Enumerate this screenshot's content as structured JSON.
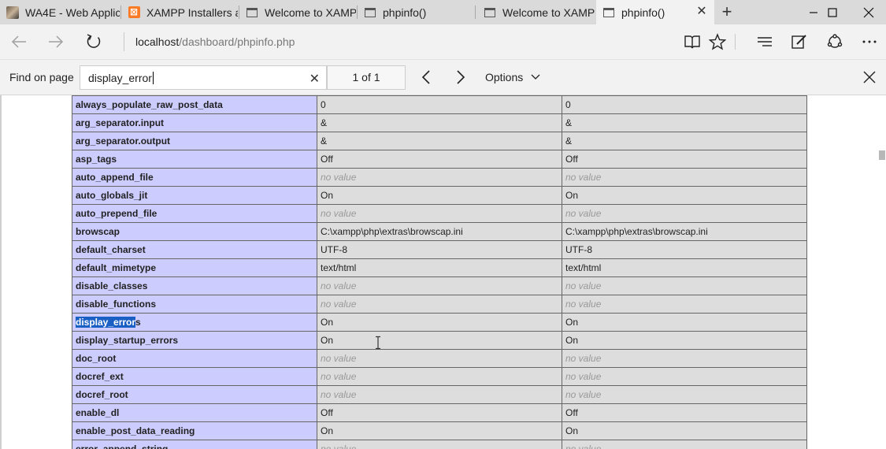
{
  "tabs": [
    {
      "title": "WA4E - Web Applic",
      "icon": "avatar-icon"
    },
    {
      "title": "XAMPP Installers ar",
      "icon": "xampp-icon"
    },
    {
      "title": "Welcome to XAMP",
      "icon": "page-icon"
    },
    {
      "title": "phpinfo()",
      "icon": "page-icon"
    },
    {
      "title": "Welcome to XAMPI",
      "icon": "page-icon"
    },
    {
      "title": "phpinfo()",
      "icon": "page-icon",
      "active": true
    }
  ],
  "address": {
    "host": "localhost",
    "path": "/dashboard/phpinfo.php"
  },
  "find": {
    "label": "Find on page",
    "query": "display_error",
    "count": "1 of 1",
    "options_label": "Options"
  },
  "table": {
    "no_value": "no value",
    "rows": [
      {
        "name": "always_populate_raw_post_data",
        "local": "0",
        "master": "0"
      },
      {
        "name": "arg_separator.input",
        "local": "&",
        "master": "&"
      },
      {
        "name": "arg_separator.output",
        "local": "&",
        "master": "&"
      },
      {
        "name": "asp_tags",
        "local": "Off",
        "master": "Off"
      },
      {
        "name": "auto_append_file",
        "local": null,
        "master": null
      },
      {
        "name": "auto_globals_jit",
        "local": "On",
        "master": "On"
      },
      {
        "name": "auto_prepend_file",
        "local": null,
        "master": null
      },
      {
        "name": "browscap",
        "local": "C:\\xampp\\php\\extras\\browscap.ini",
        "master": "C:\\xampp\\php\\extras\\browscap.ini"
      },
      {
        "name": "default_charset",
        "local": "UTF-8",
        "master": "UTF-8"
      },
      {
        "name": "default_mimetype",
        "local": "text/html",
        "master": "text/html"
      },
      {
        "name": "disable_classes",
        "local": null,
        "master": null
      },
      {
        "name": "disable_functions",
        "local": null,
        "master": null
      },
      {
        "name": "display_errors",
        "local": "On",
        "master": "On",
        "highlight": "display_error"
      },
      {
        "name": "display_startup_errors",
        "local": "On",
        "master": "On"
      },
      {
        "name": "doc_root",
        "local": null,
        "master": null
      },
      {
        "name": "docref_ext",
        "local": null,
        "master": null
      },
      {
        "name": "docref_root",
        "local": null,
        "master": null
      },
      {
        "name": "enable_dl",
        "local": "Off",
        "master": "Off"
      },
      {
        "name": "enable_post_data_reading",
        "local": "On",
        "master": "On"
      },
      {
        "name": "error_append_string",
        "local": null,
        "master": null
      }
    ]
  },
  "colors": {
    "tabstrip": "#dadada",
    "chrome": "#f2f2f2",
    "directive_bg": "#ccccff",
    "value_bg": "#dddddd",
    "find_highlight": "#1a5fc4"
  }
}
